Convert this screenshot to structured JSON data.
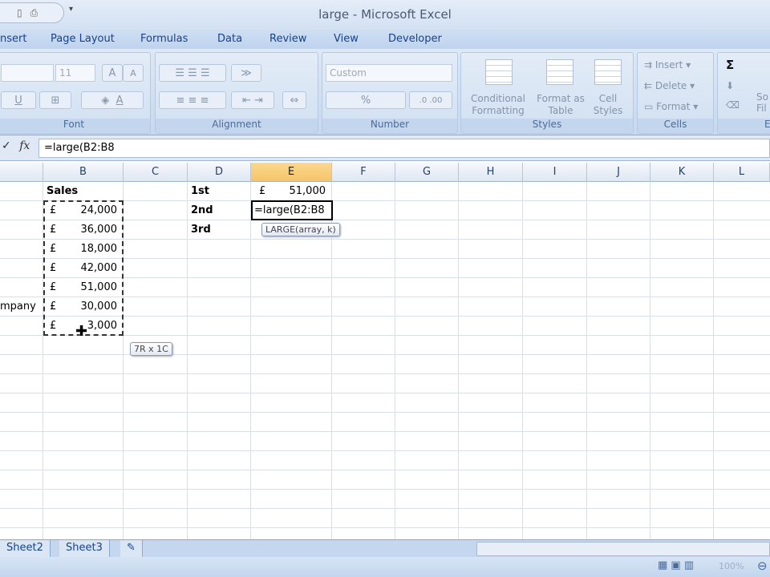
{
  "window": {
    "title": "large - Microsoft Excel"
  },
  "ribbon_tabs": [
    "nsert",
    "Page Layout",
    "Formulas",
    "Data",
    "Review",
    "View",
    "Developer"
  ],
  "font_group": {
    "label": "Font",
    "size": "11",
    "grow": "A",
    "shrink": "A",
    "underline": "U",
    "font_color": "A"
  },
  "alignment_group": {
    "label": "Alignment"
  },
  "number_group": {
    "label": "Number",
    "format": "Custom",
    "percent": "%"
  },
  "styles_group": {
    "label": "Styles",
    "conditional": "Conditional Formatting",
    "format_table": "Format as Table",
    "cell_styles": "Cell Styles"
  },
  "cells_group": {
    "label": "Cells",
    "insert": "Insert",
    "delete": "Delete",
    "format": "Format"
  },
  "editing_group": {
    "label": "E",
    "sigma": "Σ",
    "sort": "So Fil"
  },
  "formula_bar": {
    "check": "✓",
    "fx": "fx",
    "formula": "=large(B2:B8"
  },
  "columns": [
    "B",
    "C",
    "D",
    "E",
    "F",
    "G",
    "H",
    "I",
    "J",
    "K",
    "L"
  ],
  "active_column": "E",
  "cells": {
    "a7": "mpany",
    "b1": "Sales",
    "b_values": [
      {
        "cur": "£",
        "val": "24,000"
      },
      {
        "cur": "£",
        "val": "36,000"
      },
      {
        "cur": "£",
        "val": "18,000"
      },
      {
        "cur": "£",
        "val": "42,000"
      },
      {
        "cur": "£",
        "val": "51,000"
      },
      {
        "cur": "£",
        "val": "30,000"
      },
      {
        "cur": "£",
        "val": "3,000"
      }
    ],
    "d": [
      "1st",
      "2nd",
      "3rd"
    ],
    "e1": {
      "cur": "£",
      "val": "51,000"
    },
    "e2_editing": "=large(B2:B8"
  },
  "tooltips": {
    "function_hint": "LARGE(array, k)",
    "range_size": "7R x 1C"
  },
  "sheets": [
    "Sheet2",
    "Sheet3"
  ],
  "status": {
    "zoom": "100%"
  }
}
